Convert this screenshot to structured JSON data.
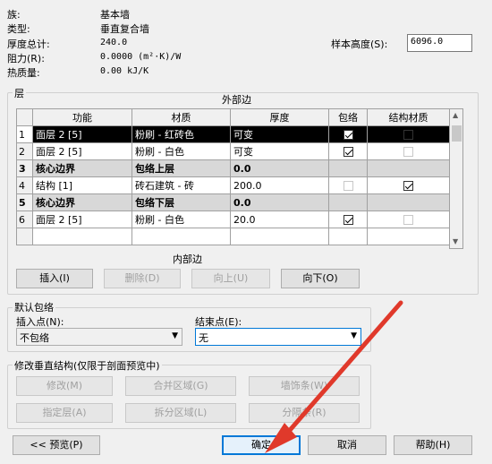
{
  "properties": {
    "family_label": "族:",
    "family_value": "基本墙",
    "type_label": "类型:",
    "type_value": "垂直复合墙",
    "thickness_label": "厚度总计:",
    "thickness_value": "240.0",
    "resistance_label": "阻力(R):",
    "resistance_value": "0.0000 (m²·K)/W",
    "thermal_label": "热质量:",
    "thermal_value": "0.00 kJ/K",
    "sample_height_label": "样本高度(S):",
    "sample_height_value": "6096.0"
  },
  "layers": {
    "title": "层",
    "exterior_label": "外部边",
    "interior_label": "内部边",
    "columns": [
      "功能",
      "材质",
      "厚度",
      "包络",
      "结构材质"
    ],
    "rows": [
      {
        "num": "1",
        "function": "面层 2 [5]",
        "material": "粉刷 - 红砖色",
        "thickness": "可变",
        "wraps": "checked",
        "structural": "filled"
      },
      {
        "num": "2",
        "function": "面层 2 [5]",
        "material": "粉刷 - 白色",
        "thickness": "可变",
        "wraps": "checked",
        "structural": "disabled"
      },
      {
        "num": "3",
        "function": "核心边界",
        "material": "包络上层",
        "thickness": "0.0",
        "wraps": "",
        "structural": ""
      },
      {
        "num": "4",
        "function": "结构 [1]",
        "material": "砖石建筑 - 砖",
        "thickness": "200.0",
        "wraps": "disabled",
        "structural": "checked"
      },
      {
        "num": "5",
        "function": "核心边界",
        "material": "包络下层",
        "thickness": "0.0",
        "wraps": "",
        "structural": ""
      },
      {
        "num": "6",
        "function": "面层 2 [5]",
        "material": "粉刷 - 白色",
        "thickness": "20.0",
        "wraps": "checked",
        "structural": "disabled"
      }
    ],
    "buttons": {
      "insert": "插入(I)",
      "delete": "删除(D)",
      "up": "向上(U)",
      "down": "向下(O)"
    }
  },
  "default_wrapping": {
    "title": "默认包络",
    "insert_point_label": "插入点(N):",
    "insert_point_value": "不包络",
    "end_point_label": "结束点(E):",
    "end_point_value": "无"
  },
  "modify_vertical": {
    "title": "修改垂直结构(仅限于剖面预览中)",
    "buttons": [
      "修改(M)",
      "合并区域(G)",
      "墙饰条(W)",
      "指定层(A)",
      "拆分区域(L)",
      "分隔条(R)"
    ]
  },
  "footer": {
    "preview": "<< 预览(P)",
    "ok": "确定",
    "cancel": "取消",
    "help": "帮助(H)"
  },
  "colors": {
    "accent": "#0078d7",
    "annotation_arrow": "#e0392b"
  }
}
